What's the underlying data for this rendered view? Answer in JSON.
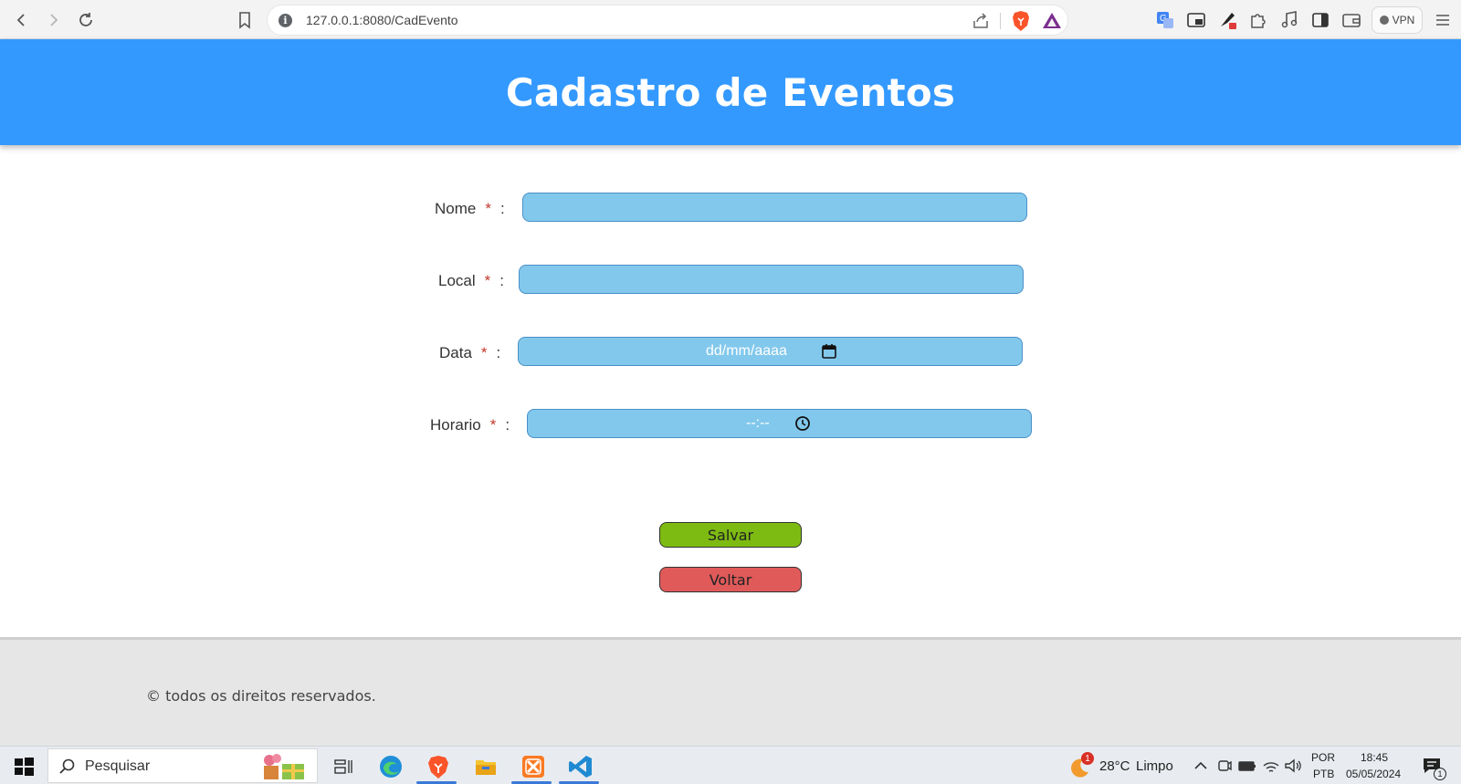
{
  "browser": {
    "url": "127.0.0.1:8080/CadEvento",
    "vpn_label": "VPN"
  },
  "page": {
    "title": "Cadastro de Eventos"
  },
  "form": {
    "fields": [
      {
        "label": "Nome",
        "required": "*",
        "colon": ":",
        "value": ""
      },
      {
        "label": "Local",
        "required": "*",
        "colon": ":",
        "value": ""
      },
      {
        "label": "Data",
        "required": "*",
        "colon": ":",
        "placeholder": "dd/mm/aaaa"
      },
      {
        "label": "Horario",
        "required": "*",
        "colon": ":",
        "placeholder": "--:--"
      }
    ],
    "save_label": "Salvar",
    "back_label": "Voltar"
  },
  "footer": {
    "copyright": "© todos os direitos reservados."
  },
  "taskbar": {
    "search_placeholder": "Pesquisar",
    "weather_temp": "28°C",
    "weather_desc": "Limpo",
    "weather_badge": "1",
    "lang_top": "POR",
    "lang_bottom": "PTB",
    "time": "18:45",
    "date": "05/05/2024",
    "notification_count": "1"
  },
  "colors": {
    "header": "#3399ff",
    "input_bg": "#82c8ec",
    "save": "#7dbb12",
    "back": "#e05a5a"
  }
}
